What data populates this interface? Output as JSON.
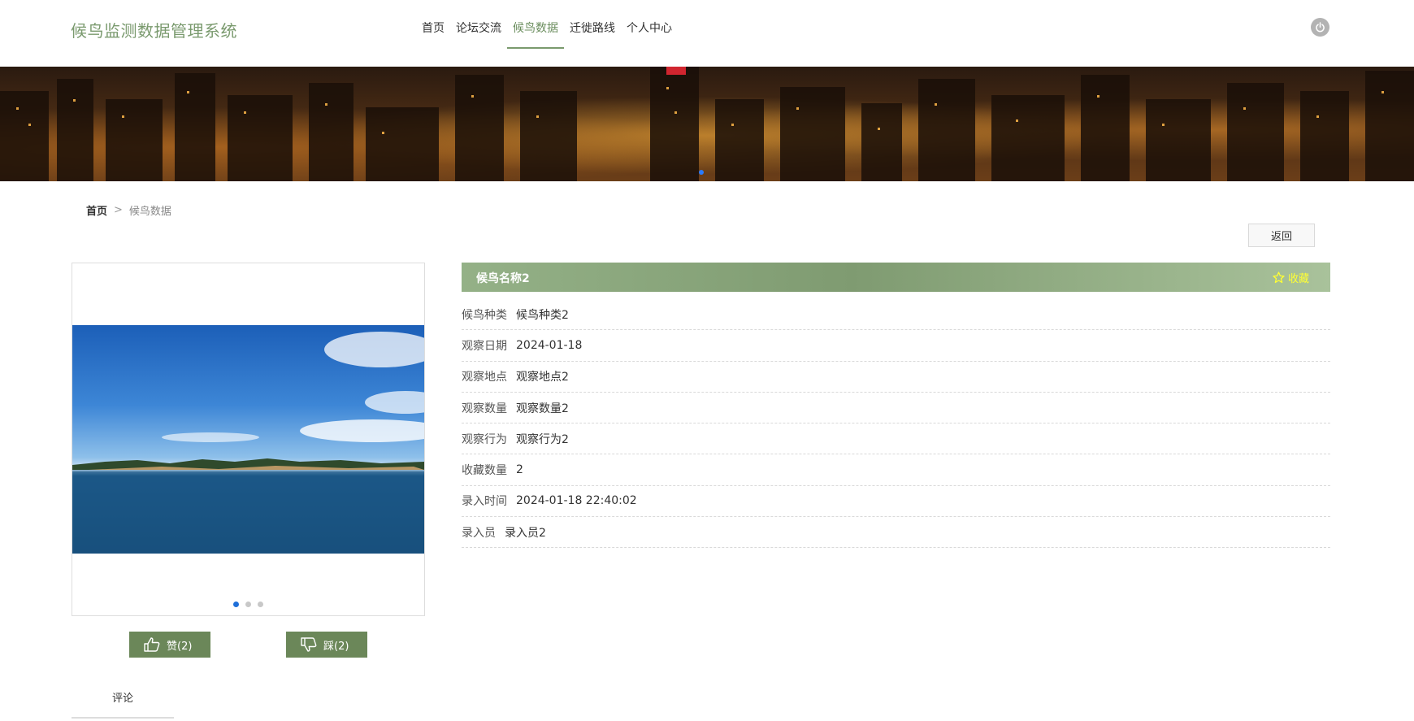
{
  "header": {
    "logo": "候鸟监测数据管理系统",
    "nav": [
      "首页",
      "论坛交流",
      "候鸟数据",
      "迁徙路线",
      "个人中心"
    ],
    "active_nav": "候鸟数据"
  },
  "breadcrumb": {
    "home": "首页",
    "separator": ">",
    "current": "候鸟数据"
  },
  "back_label": "返回",
  "detail": {
    "title": "候鸟名称2",
    "favorite_label": "收藏",
    "rows": [
      {
        "key": "候鸟种类",
        "value": "候鸟种类2"
      },
      {
        "key": "观察日期",
        "value": "2024-01-18"
      },
      {
        "key": "观察地点",
        "value": "观察地点2"
      },
      {
        "key": "观察数量",
        "value": "观察数量2"
      },
      {
        "key": "观察行为",
        "value": "观察行为2"
      },
      {
        "key": "收藏数量",
        "value": "2"
      },
      {
        "key": "录入时间",
        "value": "2024-01-18 22:40:02"
      },
      {
        "key": "录入员",
        "value": "录入员2"
      }
    ]
  },
  "votes": {
    "like_label": "赞(2)",
    "dislike_label": "踩(2)"
  },
  "comment_tab": "评论",
  "carousel": {
    "slides": 3,
    "active": 1
  },
  "colors": {
    "accent": "#7a9a6e",
    "button": "#6b8759",
    "favorite": "#ffff33",
    "active_dot": "#1e6fd9"
  }
}
